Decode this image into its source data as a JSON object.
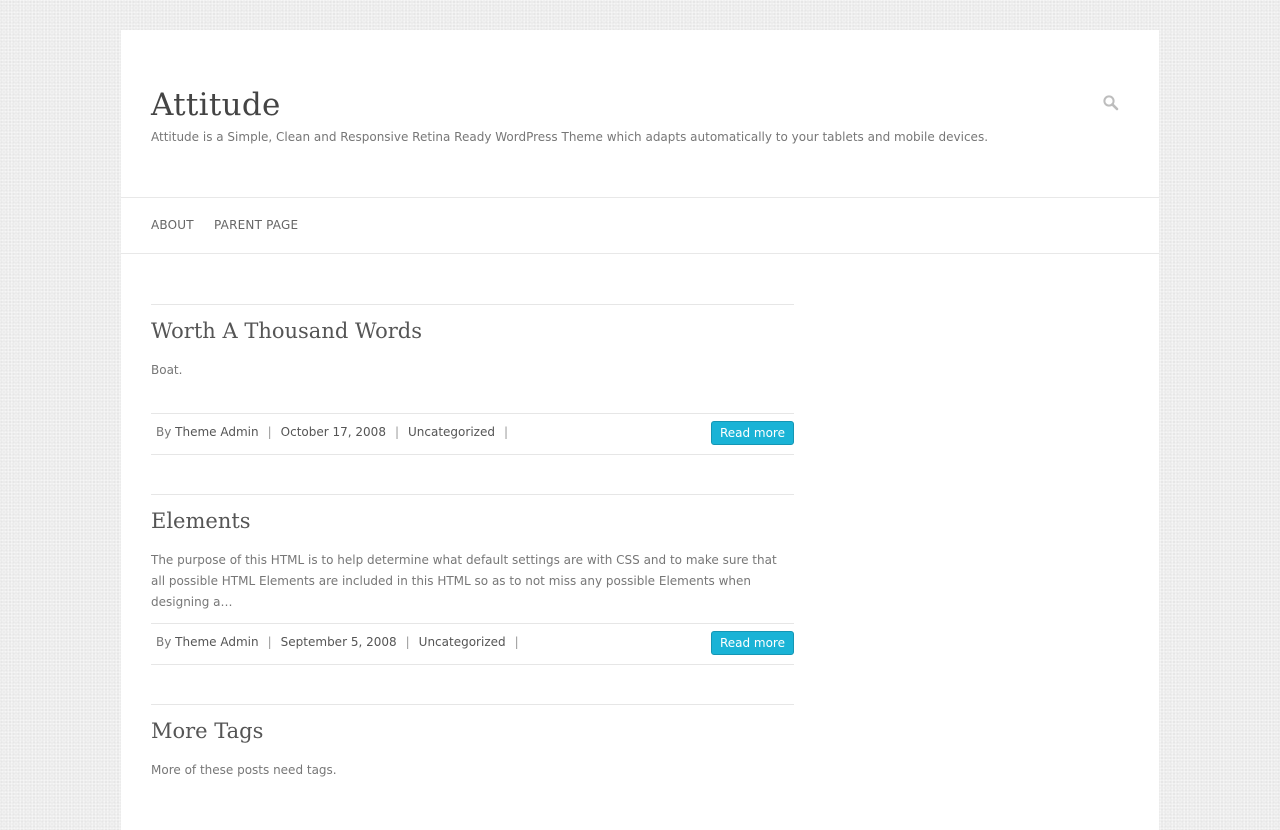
{
  "header": {
    "site_title": "Attitude",
    "site_description": "Attitude is a Simple, Clean and Responsive Retina Ready WordPress Theme which adapts automatically to your tablets and mobile devices.",
    "search_icon": "search-icon"
  },
  "nav": {
    "items": [
      {
        "label": "ABOUT"
      },
      {
        "label": "PARENT PAGE"
      }
    ]
  },
  "posts": [
    {
      "title": "Worth A Thousand Words",
      "excerpt": "Boat.",
      "by": "By",
      "author": "Theme Admin",
      "date": "October 17, 2008",
      "category": "Uncategorized",
      "read_more": "Read more"
    },
    {
      "title": "Elements",
      "excerpt": "The purpose of this HTML is to help determine what default settings are with CSS and to make sure that all possible HTML Elements are included in this HTML so as to not miss any possible Elements when designing a…",
      "by": "By",
      "author": "Theme Admin",
      "date": "September 5, 2008",
      "category": "Uncategorized",
      "read_more": "Read more"
    },
    {
      "title": "More Tags",
      "excerpt": "More of these posts need tags."
    }
  ],
  "colors": {
    "accent": "#1ab3d6",
    "background": "#ececec"
  }
}
